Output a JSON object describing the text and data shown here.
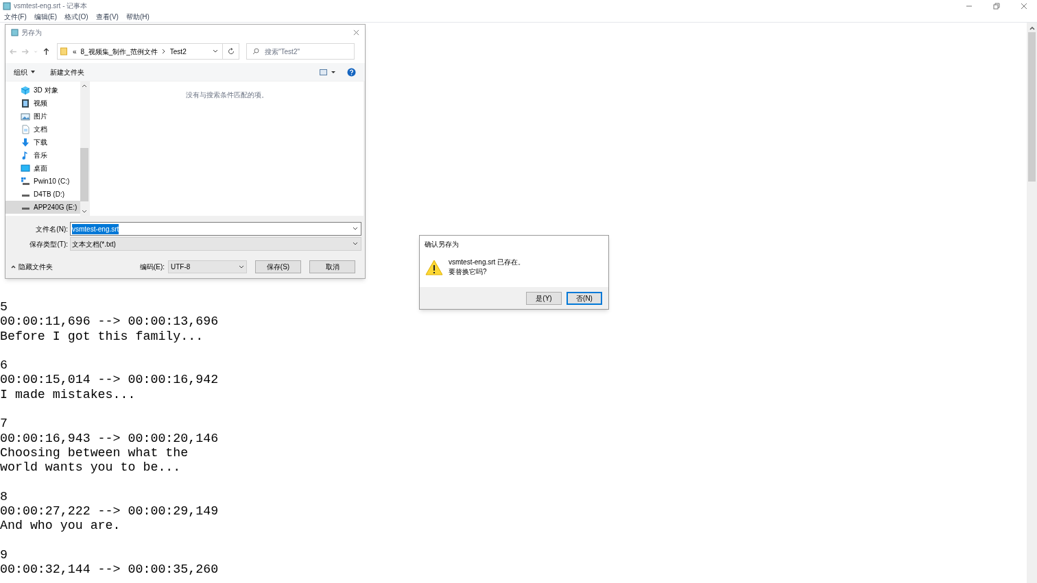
{
  "window": {
    "title": "vsmtest-eng.srt - 记事本"
  },
  "menu": [
    "文件(F)",
    "编辑(E)",
    "格式(O)",
    "查看(V)",
    "帮助(H)"
  ],
  "editor": {
    "blocks": [
      {
        "lines": [
          "5",
          "00:00:11,696 --> 00:00:13,696",
          "Before I got this family..."
        ]
      },
      {
        "lines": [
          "6",
          "00:00:15,014 --> 00:00:16,942",
          "I made mistakes..."
        ]
      },
      {
        "lines": [
          "7",
          "00:00:16,943 --> 00:00:20,146",
          "Choosing between what the",
          "world wants you to be..."
        ]
      },
      {
        "lines": [
          "8",
          "00:00:27,222 --> 00:00:29,149",
          "And who you are."
        ]
      },
      {
        "lines": [
          "9",
          "00:00:32,144 --> 00:00:35,260"
        ]
      }
    ]
  },
  "save_dialog": {
    "title": "另存为",
    "nav": [
      {
        "kind": "back",
        "disabled": true
      },
      {
        "kind": "forward",
        "disabled": true
      },
      {
        "kind": "recent",
        "disabled": true
      },
      {
        "kind": "up",
        "disabled": false
      }
    ],
    "breadcrumb": {
      "overflow": "«",
      "segments": [
        "8_视频集_制作_范例文件",
        "Test2"
      ]
    },
    "search": {
      "placeholder": "搜索\"Test2\""
    },
    "toolbar": [
      {
        "label": "组织",
        "menu": true
      },
      {
        "label": "新建文件夹",
        "menu": false
      }
    ],
    "tree": [
      {
        "label": "3D 对象",
        "kind": "cube",
        "selected": false
      },
      {
        "label": "视频",
        "kind": "video",
        "selected": false
      },
      {
        "label": "图片",
        "kind": "picture",
        "selected": false
      },
      {
        "label": "文档",
        "kind": "document",
        "selected": false
      },
      {
        "label": "下载",
        "kind": "download",
        "selected": false
      },
      {
        "label": "音乐",
        "kind": "music",
        "selected": false
      },
      {
        "label": "桌面",
        "kind": "desktop",
        "selected": false
      },
      {
        "label": "Pwin10 (C:)",
        "kind": "system-drive",
        "selected": false
      },
      {
        "label": "D4TB (D:)",
        "kind": "drive",
        "selected": false
      },
      {
        "label": "APP240G (E:)",
        "kind": "drive",
        "selected": true
      }
    ],
    "empty_message": "没有与搜索条件匹配的项。",
    "filename": {
      "label": "文件名(N):",
      "value": "vsmtest-eng.srt",
      "value_selected": true
    },
    "filetype": {
      "label": "保存类型(T):",
      "value": "文本文档(*.txt)"
    },
    "hide_folders": "隐藏文件夹",
    "encoding": {
      "label": "编码(E):",
      "value": "UTF-8"
    },
    "buttons": [
      {
        "label": "保存(S)",
        "focused": false
      },
      {
        "label": "取消",
        "focused": false
      }
    ]
  },
  "confirm_dialog": {
    "title": "确认另存为",
    "message": [
      "vsmtest-eng.srt 已存在。",
      "要替换它吗?"
    ],
    "buttons": [
      {
        "label": "是(Y)",
        "focused": false
      },
      {
        "label": "否(N)",
        "focused": true
      }
    ]
  }
}
